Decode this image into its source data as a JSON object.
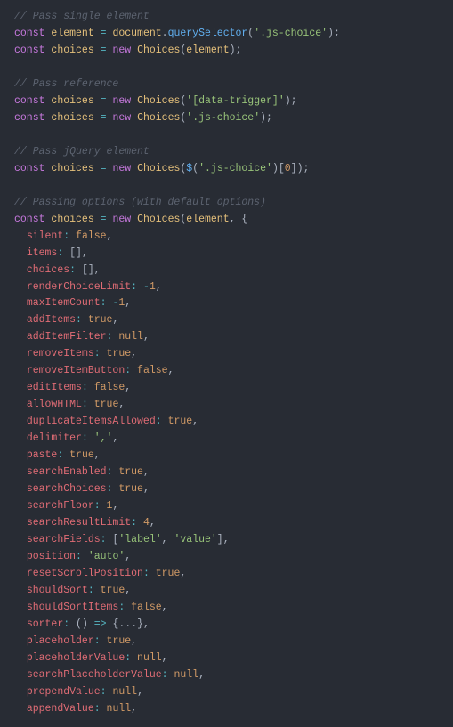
{
  "code": {
    "sections": [
      {
        "comment": "// Pass single element",
        "lines": [
          {
            "tokens": [
              "const",
              " ",
              "element",
              " ",
              "=",
              " ",
              "document",
              ".",
              "querySelector",
              "(",
              "'.js-choice'",
              ")",
              ";"
            ],
            "classes": [
              "c-const",
              "",
              "c-var",
              "",
              "c-op",
              "",
              "c-var",
              "c-punct",
              "c-func",
              "c-punct",
              "c-string",
              "c-punct",
              "c-punct"
            ]
          },
          {
            "tokens": [
              "const",
              " ",
              "choices",
              " ",
              "=",
              " ",
              "new",
              " ",
              "Choices",
              "(",
              "element",
              ")",
              ";"
            ],
            "classes": [
              "c-const",
              "",
              "c-var",
              "",
              "c-op",
              "",
              "c-keyword",
              "",
              "c-class",
              "c-punct",
              "c-var",
              "c-punct",
              "c-punct"
            ]
          }
        ]
      },
      {
        "comment": "// Pass reference",
        "lines": [
          {
            "tokens": [
              "const",
              " ",
              "choices",
              " ",
              "=",
              " ",
              "new",
              " ",
              "Choices",
              "(",
              "'[data-trigger]'",
              ")",
              ";"
            ],
            "classes": [
              "c-const",
              "",
              "c-var",
              "",
              "c-op",
              "",
              "c-keyword",
              "",
              "c-class",
              "c-punct",
              "c-string",
              "c-punct",
              "c-punct"
            ]
          },
          {
            "tokens": [
              "const",
              " ",
              "choices",
              " ",
              "=",
              " ",
              "new",
              " ",
              "Choices",
              "(",
              "'.js-choice'",
              ")",
              ";"
            ],
            "classes": [
              "c-const",
              "",
              "c-var",
              "",
              "c-op",
              "",
              "c-keyword",
              "",
              "c-class",
              "c-punct",
              "c-string",
              "c-punct",
              "c-punct"
            ]
          }
        ]
      },
      {
        "comment": "// Pass jQuery element",
        "lines": [
          {
            "tokens": [
              "const",
              " ",
              "choices",
              " ",
              "=",
              " ",
              "new",
              " ",
              "Choices",
              "(",
              "$",
              "(",
              "'.js-choice'",
              ")",
              "[",
              "0",
              "]",
              ")",
              ";"
            ],
            "classes": [
              "c-const",
              "",
              "c-var",
              "",
              "c-op",
              "",
              "c-keyword",
              "",
              "c-class",
              "c-punct",
              "c-func",
              "c-punct",
              "c-string",
              "c-punct",
              "c-punct",
              "c-num",
              "c-punct",
              "c-punct",
              "c-punct"
            ]
          }
        ]
      },
      {
        "comment": "// Passing options (with default options)",
        "lines": [
          {
            "tokens": [
              "const",
              " ",
              "choices",
              " ",
              "=",
              " ",
              "new",
              " ",
              "Choices",
              "(",
              "element",
              ",",
              " ",
              "{"
            ],
            "classes": [
              "c-const",
              "",
              "c-var",
              "",
              "c-op",
              "",
              "c-keyword",
              "",
              "c-class",
              "c-punct",
              "c-var",
              "c-punct",
              "",
              "c-punct"
            ]
          }
        ],
        "options": [
          {
            "key": "silent",
            "val": "false",
            "vclass": "c-bool"
          },
          {
            "key": "items",
            "val": "[]",
            "vclass": "c-punct"
          },
          {
            "key": "choices",
            "val": "[]",
            "vclass": "c-punct"
          },
          {
            "key": "renderChoiceLimit",
            "val": "-1",
            "vclass": "c-num"
          },
          {
            "key": "maxItemCount",
            "val": "-1",
            "vclass": "c-num"
          },
          {
            "key": "addItems",
            "val": "true",
            "vclass": "c-bool"
          },
          {
            "key": "addItemFilter",
            "val": "null",
            "vclass": "c-bool"
          },
          {
            "key": "removeItems",
            "val": "true",
            "vclass": "c-bool"
          },
          {
            "key": "removeItemButton",
            "val": "false",
            "vclass": "c-bool"
          },
          {
            "key": "editItems",
            "val": "false",
            "vclass": "c-bool"
          },
          {
            "key": "allowHTML",
            "val": "true",
            "vclass": "c-bool"
          },
          {
            "key": "duplicateItemsAllowed",
            "val": "true",
            "vclass": "c-bool"
          },
          {
            "key": "delimiter",
            "val": "','",
            "vclass": "c-string"
          },
          {
            "key": "paste",
            "val": "true",
            "vclass": "c-bool"
          },
          {
            "key": "searchEnabled",
            "val": "true",
            "vclass": "c-bool"
          },
          {
            "key": "searchChoices",
            "val": "true",
            "vclass": "c-bool"
          },
          {
            "key": "searchFloor",
            "val": "1",
            "vclass": "c-num"
          },
          {
            "key": "searchResultLimit",
            "val": "4",
            "vclass": "c-num"
          },
          {
            "key": "searchFields",
            "val": "['label', 'value']",
            "vclass": "c-string",
            "raw": true
          },
          {
            "key": "position",
            "val": "'auto'",
            "vclass": "c-string"
          },
          {
            "key": "resetScrollPosition",
            "val": "true",
            "vclass": "c-bool"
          },
          {
            "key": "shouldSort",
            "val": "true",
            "vclass": "c-bool"
          },
          {
            "key": "shouldSortItems",
            "val": "false",
            "vclass": "c-bool"
          },
          {
            "key": "sorter",
            "val": "() => {...}",
            "vclass": "c-punct",
            "raw": true
          },
          {
            "key": "placeholder",
            "val": "true",
            "vclass": "c-bool"
          },
          {
            "key": "placeholderValue",
            "val": "null",
            "vclass": "c-bool"
          },
          {
            "key": "searchPlaceholderValue",
            "val": "null",
            "vclass": "c-bool"
          },
          {
            "key": "prependValue",
            "val": "null",
            "vclass": "c-bool"
          },
          {
            "key": "appendValue",
            "val": "null",
            "vclass": "c-bool"
          }
        ]
      }
    ]
  }
}
